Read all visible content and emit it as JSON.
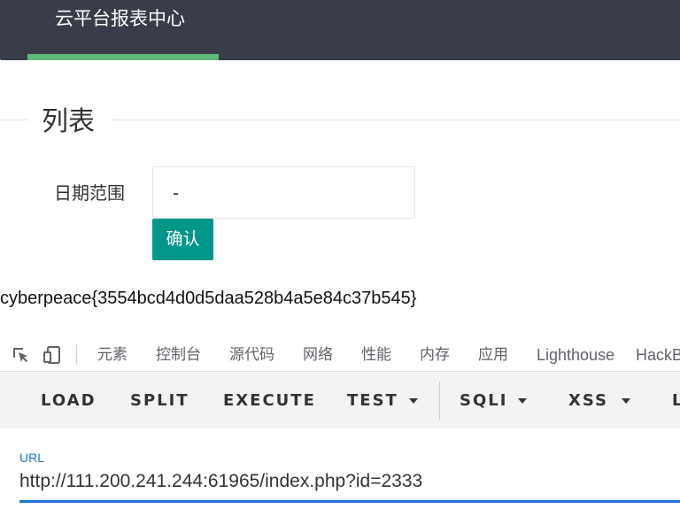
{
  "nav": {
    "title": "云平台报表中心",
    "active_indicator_color": "#5fb878"
  },
  "fieldset": {
    "legend": "列表"
  },
  "form": {
    "date_label": "日期范围",
    "date_value": "-",
    "confirm_label": "确认",
    "accent_color": "#009688"
  },
  "output": {
    "flag_text": "cyberpeace{3554bcd4d0d5daa528b4a5e84c37b545}"
  },
  "devtools": {
    "icons": [
      "element-picker-icon",
      "device-toolbar-icon"
    ],
    "tabs": [
      "元素",
      "控制台",
      "源代码",
      "网络",
      "性能",
      "内存",
      "应用",
      "Lighthouse",
      "HackBar"
    ]
  },
  "hackbar": {
    "buttons": [
      "LOAD",
      "SPLIT",
      "EXECUTE",
      "TEST",
      "SQLI",
      "XSS",
      "LFI"
    ]
  },
  "url_field": {
    "label": "URL",
    "value": "http://111.200.241.244:61965/index.php?id=2333",
    "accent_color": "#1976d2"
  }
}
